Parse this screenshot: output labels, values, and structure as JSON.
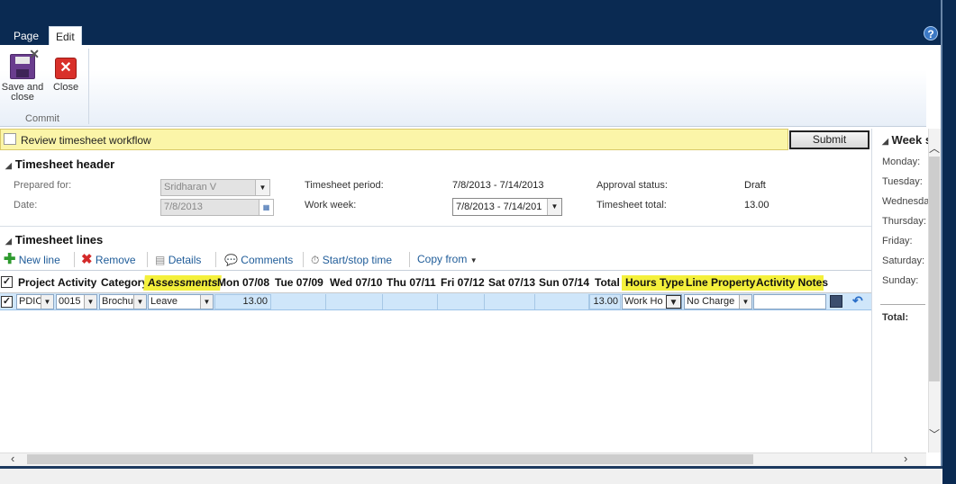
{
  "ribbon": {
    "tabs": [
      "Page",
      "Edit"
    ],
    "help": "?",
    "save_label_1": "Save and",
    "save_label_2": "close",
    "close_label": "Close",
    "group_label": "Commit"
  },
  "workflow": {
    "text": "Review timesheet workflow",
    "submit": "Submit"
  },
  "header": {
    "title": "Timesheet header",
    "prepared_for_label": "Prepared for:",
    "prepared_for_value": "Sridharan V",
    "date_label": "Date:",
    "date_value": "7/8/2013",
    "period_label": "Timesheet period:",
    "period_value": "7/8/2013 - 7/14/2013",
    "work_week_label": "Work week:",
    "work_week_value": "7/8/2013 - 7/14/201",
    "approval_label": "Approval status:",
    "approval_value": "Draft",
    "total_label": "Timesheet total:",
    "total_value": "13.00"
  },
  "lines": {
    "title": "Timesheet lines",
    "toolbar": {
      "new_line": "New line",
      "remove": "Remove",
      "details": "Details",
      "comments": "Comments",
      "start_stop": "Start/stop time",
      "copy_from": "Copy from"
    },
    "columns": {
      "project": "Project",
      "activity": "Activity",
      "category": "Category",
      "assessments": "Assessments",
      "mon": "Mon 07/08",
      "tue": "Tue 07/09",
      "wed": "Wed 07/10",
      "thu": "Thu 07/11",
      "fri": "Fri 07/12",
      "sat": "Sat 07/13",
      "sun": "Sun 07/14",
      "total": "Total",
      "hours_type": "Hours Type",
      "line_property": "Line Property",
      "activity_notes": "Activity Notes"
    },
    "row": {
      "project": "PDIC",
      "activity": "0015",
      "category": "Brochu",
      "assessments": "Leave",
      "mon": "13.00",
      "total": "13.00",
      "hours_type": "Work Ho",
      "line_property": "No Charge"
    }
  },
  "week_summary": {
    "title": "Week s",
    "days": [
      "Monday:",
      "Tuesday:",
      "Wednesda",
      "Thursday:",
      "Friday:",
      "Saturday:",
      "Sunday:"
    ],
    "total_label": "Total:"
  }
}
